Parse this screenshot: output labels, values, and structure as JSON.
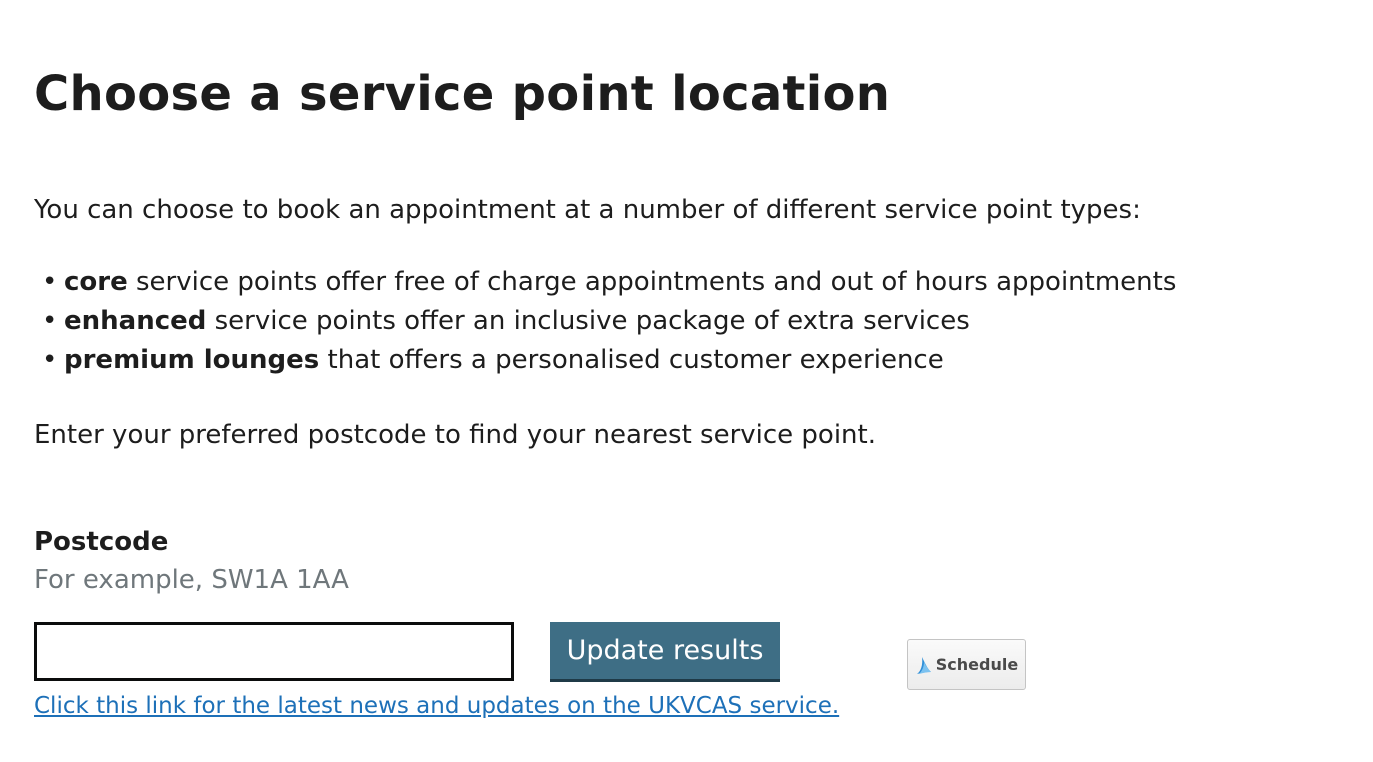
{
  "page": {
    "title": "Choose a service point location",
    "intro": "You can choose to book an appointment at a number of different service point types:",
    "service_types": [
      {
        "bullet": "•",
        "name": "core",
        "description": " service points offer free of charge appointments and out of hours appointments"
      },
      {
        "bullet": "•",
        "name": "enhanced",
        "description": " service points offer an inclusive package of extra services"
      },
      {
        "bullet": "•",
        "name": "premium lounges",
        "description": " that offers a personalised customer experience"
      }
    ],
    "postcode_prompt": "Enter your preferred postcode to find your nearest service point."
  },
  "form": {
    "postcode_label": "Postcode",
    "postcode_example": "For example, SW1A 1AA",
    "postcode_value": "",
    "update_button_label": "Update results",
    "news_link_text": "Click this link for the latest news and updates on the UKVCAS service."
  },
  "schedule_widget": {
    "label": "Schedule",
    "icon": "schedule-wing-icon"
  },
  "colors": {
    "button_bg": "#3e6e85",
    "link": "#1d70b8",
    "hint_text": "#6f777b",
    "text": "#1d1d1d"
  }
}
